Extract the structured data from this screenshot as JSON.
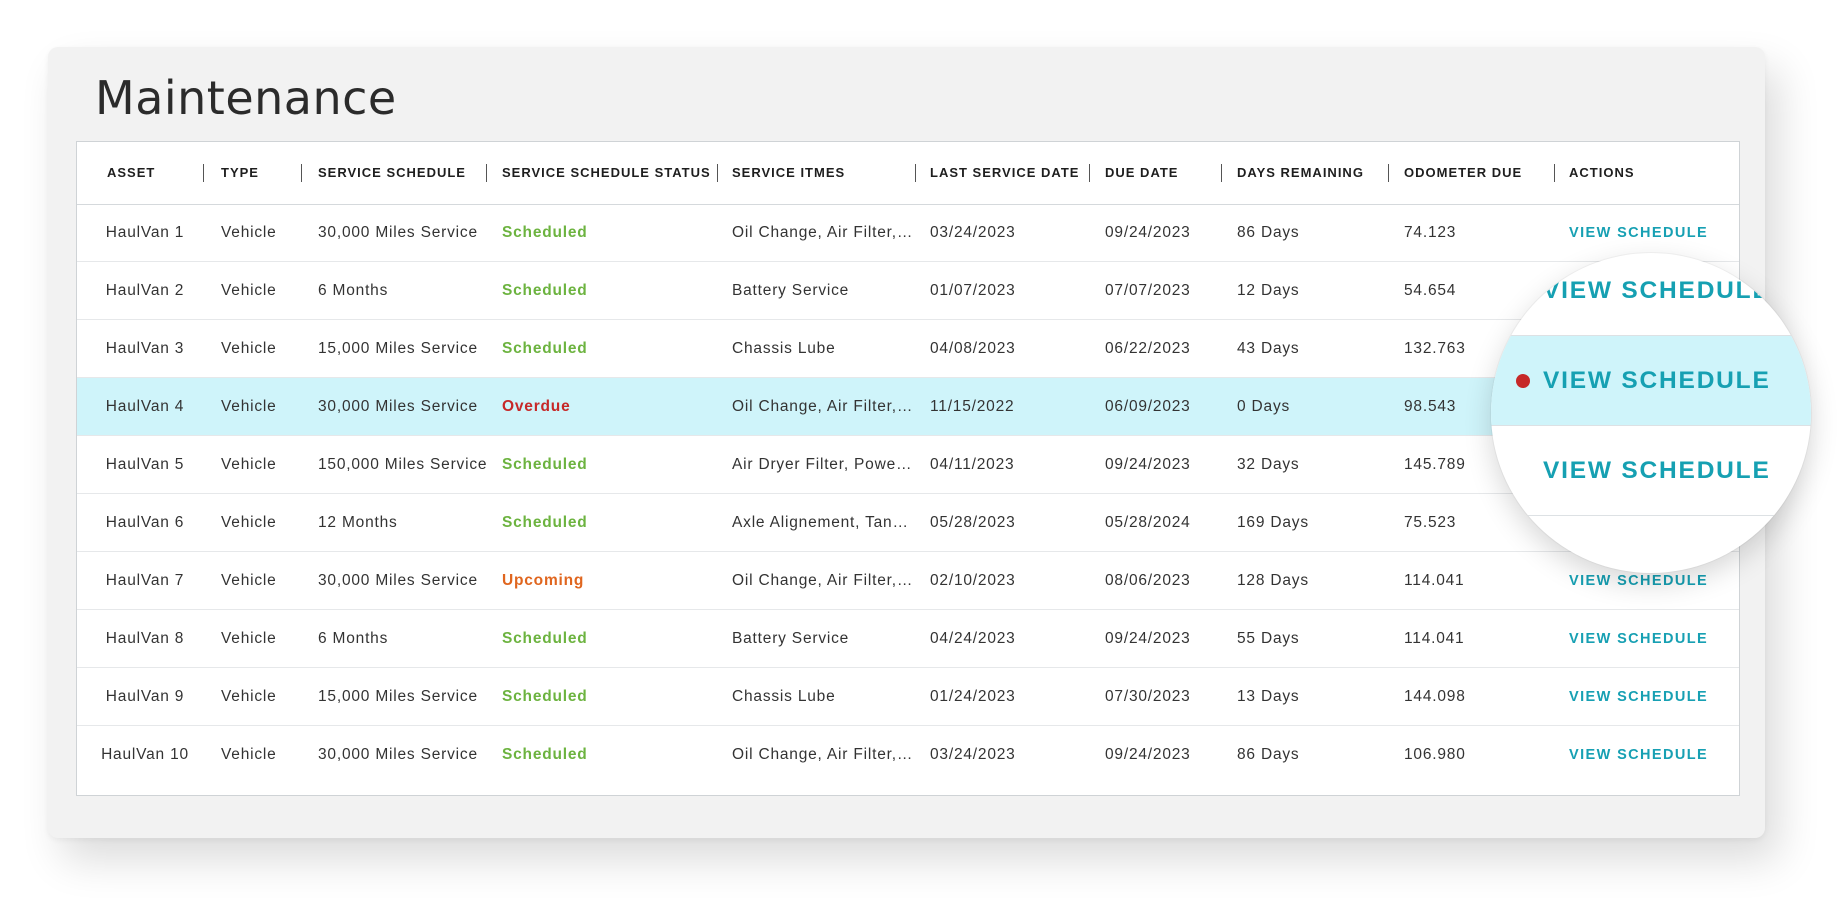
{
  "title": "Maintenance",
  "columns": [
    "ASSET",
    "TYPE",
    "SERVICE SCHEDULE",
    "SERVICE SCHEDULE STATUS",
    "SERVICE ITMES",
    "LAST SERVICE DATE",
    "DUE DATE",
    "DAYS REMAINING",
    "ODOMETER DUE",
    "ACTIONS"
  ],
  "action_label": "VIEW SCHEDULE",
  "status_colors": {
    "Scheduled": "#6cb33f",
    "Overdue": "#c62828",
    "Upcoming": "#e0661f"
  },
  "highlight_color": "#cff4fa",
  "accent_color": "#17a0b3",
  "rows": [
    {
      "asset": "HaulVan 1",
      "type": "Vehicle",
      "schedule": "30,000 Miles Service",
      "status": "Scheduled",
      "items": "Oil Change, Air Filter, Tire Rotation",
      "last_service": "03/24/2023",
      "due": "09/24/2023",
      "days_remaining": "86 Days",
      "odometer": "74.123",
      "highlighted": false
    },
    {
      "asset": "HaulVan 2",
      "type": "Vehicle",
      "schedule": "6 Months",
      "status": "Scheduled",
      "items": "Battery Service",
      "last_service": "01/07/2023",
      "due": "07/07/2023",
      "days_remaining": "12 Days",
      "odometer": "54.654",
      "highlighted": false
    },
    {
      "asset": "HaulVan 3",
      "type": "Vehicle",
      "schedule": "15,000 Miles Service",
      "status": "Scheduled",
      "items": "Chassis Lube",
      "last_service": "04/08/2023",
      "due": "06/22/2023",
      "days_remaining": "43 Days",
      "odometer": "132.763",
      "highlighted": false
    },
    {
      "asset": "HaulVan 4",
      "type": "Vehicle",
      "schedule": "30,000 Miles Service",
      "status": "Overdue",
      "items": "Oil Change, Air Filter, Tire Rotation",
      "last_service": "11/15/2022",
      "due": "06/09/2023",
      "days_remaining": "0 Days",
      "odometer": "98.543",
      "highlighted": true
    },
    {
      "asset": "HaulVan 5",
      "type": "Vehicle",
      "schedule": "150,000 Miles Service",
      "status": "Scheduled",
      "items": "Air Dryer Filter, Power Steering",
      "last_service": "04/11/2023",
      "due": "09/24/2023",
      "days_remaining": "32 Days",
      "odometer": "145.789",
      "highlighted": false
    },
    {
      "asset": "HaulVan 6",
      "type": "Vehicle",
      "schedule": "12 Months",
      "status": "Scheduled",
      "items": "Axle Alignement, Tank Inspection",
      "last_service": "05/28/2023",
      "due": "05/28/2024",
      "days_remaining": "169 Days",
      "odometer": "75.523",
      "highlighted": false
    },
    {
      "asset": "HaulVan 7",
      "type": "Vehicle",
      "schedule": "30,000 Miles Service",
      "status": "Upcoming",
      "items": "Oil Change, Air Filter, Tire Rotation",
      "last_service": "02/10/2023",
      "due": "08/06/2023",
      "days_remaining": "128 Days",
      "odometer": "114.041",
      "highlighted": false
    },
    {
      "asset": "HaulVan 8",
      "type": "Vehicle",
      "schedule": "6 Months",
      "status": "Scheduled",
      "items": "Battery Service",
      "last_service": "04/24/2023",
      "due": "09/24/2023",
      "days_remaining": "55 Days",
      "odometer": "114.041",
      "highlighted": false
    },
    {
      "asset": "HaulVan 9",
      "type": "Vehicle",
      "schedule": "15,000 Miles Service",
      "status": "Scheduled",
      "items": "Chassis Lube",
      "last_service": "01/24/2023",
      "due": "07/30/2023",
      "days_remaining": "13 Days",
      "odometer": "144.098",
      "highlighted": false
    },
    {
      "asset": "HaulVan 10",
      "type": "Vehicle",
      "schedule": "30,000 Miles Service",
      "status": "Scheduled",
      "items": "Oil Change, Air Filter, Tire Rotation",
      "last_service": "03/24/2023",
      "due": "09/24/2023",
      "days_remaining": "86 Days",
      "odometer": "106.980",
      "highlighted": false
    }
  ],
  "magnifier": {
    "labels": [
      "VIEW SCHEDULE",
      "VIEW SCHEDULE",
      "VIEW SCHEDULE"
    ],
    "active_index": 1
  }
}
